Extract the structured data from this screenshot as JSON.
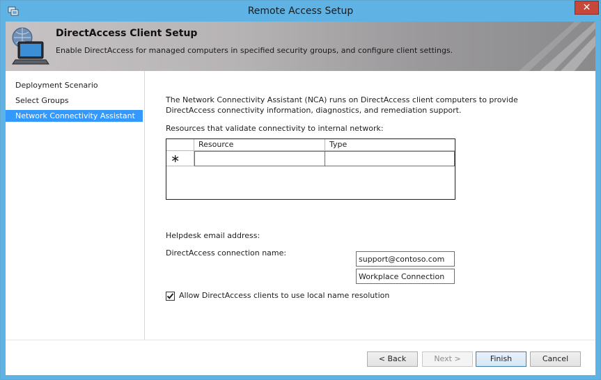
{
  "window": {
    "title": "Remote Access Setup",
    "close_label": "✕"
  },
  "banner": {
    "title": "DirectAccess Client Setup",
    "subtitle": "Enable DirectAccess for managed computers in specified security groups, and configure client settings."
  },
  "nav": {
    "items": [
      {
        "label": "Deployment Scenario"
      },
      {
        "label": "Select Groups"
      },
      {
        "label": "Network Connectivity Assistant"
      }
    ],
    "selected_index": 2
  },
  "content": {
    "description_line1": "The Network Connectivity Assistant (NCA) runs on DirectAccess client computers to provide",
    "description_line2": "DirectAccess connectivity information, diagnostics, and remediation support.",
    "resources_label": "Resources that validate connectivity to internal network:",
    "grid": {
      "columns": [
        "Resource",
        "Type"
      ],
      "new_row_marker": "∗",
      "rows": []
    },
    "helpdesk_label": "Helpdesk email address:",
    "helpdesk_value": "support@contoso.com",
    "connection_label": "DirectAccess connection name:",
    "connection_value": "Workplace Connection",
    "local_name_resolution_label": "Allow DirectAccess clients to use local name resolution",
    "local_name_resolution_checked": true
  },
  "footer": {
    "back_label": "< Back",
    "next_label": "Next >",
    "finish_label": "Finish",
    "cancel_label": "Cancel"
  },
  "colors": {
    "title_bar": "#5fb2e4",
    "selection": "#3399ff",
    "close_button": "#c7483a"
  }
}
